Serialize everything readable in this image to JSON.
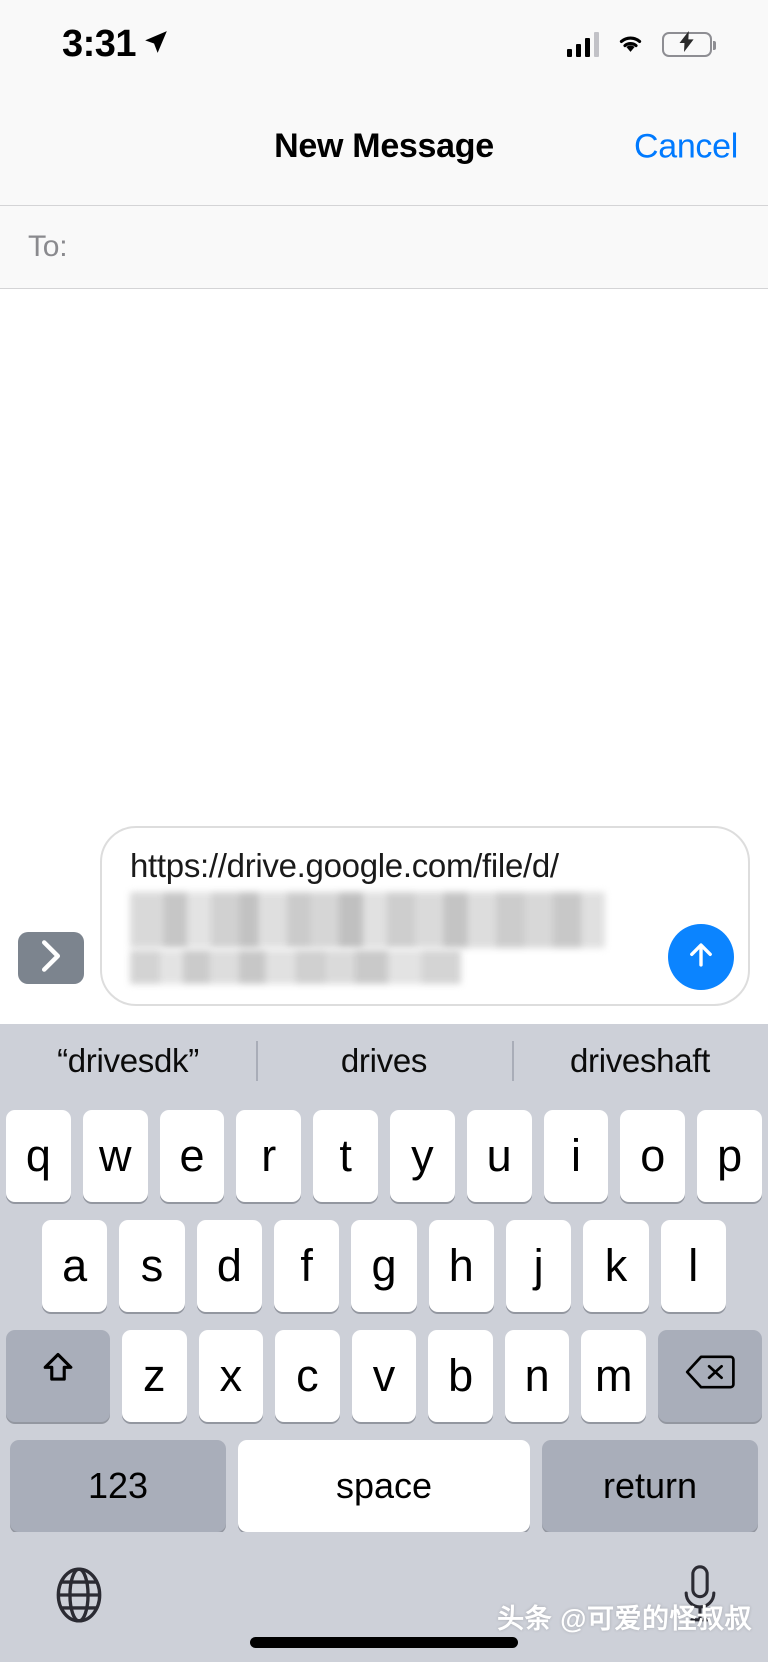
{
  "status_bar": {
    "time": "3:31",
    "location_icon": "location-arrow-icon",
    "signal_icon": "cellular-signal-icon",
    "wifi_icon": "wifi-icon",
    "battery_icon": "battery-charging-icon",
    "battery_color": "#4cd964"
  },
  "nav_bar": {
    "title": "New Message",
    "cancel_label": "Cancel",
    "accent_color": "#007aff"
  },
  "recipient": {
    "label": "To:",
    "value": "",
    "placeholder": ""
  },
  "compose": {
    "expand_icon": "chevron-right-icon",
    "text_line1": "https://drive.google.com/file/d/",
    "text_line2_redacted": true,
    "send_icon": "arrow-up-icon",
    "send_color": "#0b84ff"
  },
  "keyboard": {
    "suggestions": [
      "“drivesdk”",
      "drives",
      "driveshaft"
    ],
    "row1": [
      "q",
      "w",
      "e",
      "r",
      "t",
      "y",
      "u",
      "i",
      "o",
      "p"
    ],
    "row2": [
      "a",
      "s",
      "d",
      "f",
      "g",
      "h",
      "j",
      "k",
      "l"
    ],
    "row3_letters": [
      "z",
      "x",
      "c",
      "v",
      "b",
      "n",
      "m"
    ],
    "shift_icon": "shift-arrow-up-icon",
    "backspace_icon": "backspace-delete-icon",
    "numbers_label": "123",
    "space_label": "space",
    "return_label": "return",
    "globe_icon": "globe-language-icon",
    "mic_icon": "microphone-icon",
    "background_color": "#cdd0d8",
    "key_color": "#ffffff",
    "modifier_key_color": "#a9aeba"
  },
  "watermark": {
    "text": "头条 @可爱的怪叔叔"
  }
}
